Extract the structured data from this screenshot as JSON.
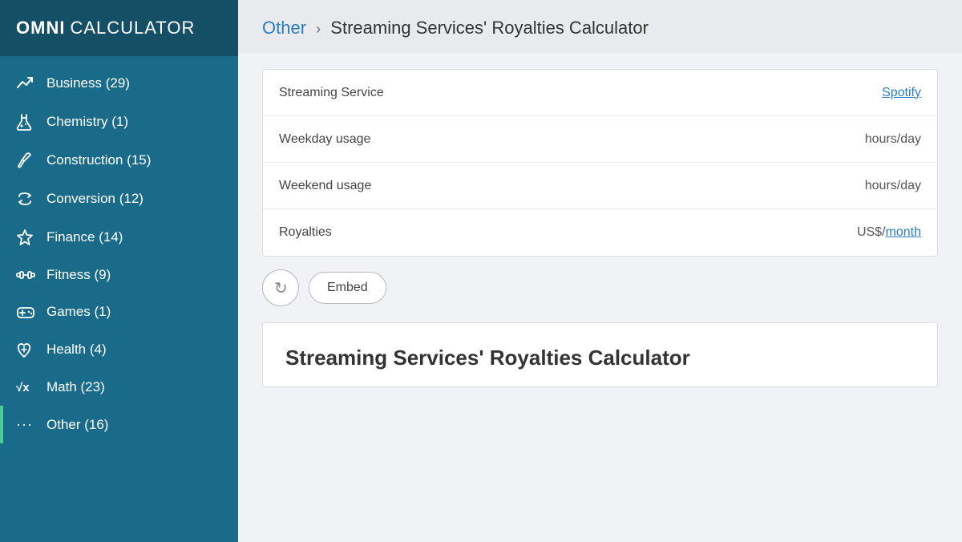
{
  "sidebar": {
    "logo_omni": "OMNI",
    "logo_calculator": "CALCULATOR",
    "items": [
      {
        "id": "business",
        "label": "Business (29)",
        "icon": "📈"
      },
      {
        "id": "chemistry",
        "label": "Chemistry (1)",
        "icon": "🧪"
      },
      {
        "id": "construction",
        "label": "Construction (15)",
        "icon": "🔧"
      },
      {
        "id": "conversion",
        "label": "Conversion (12)",
        "icon": "🔄"
      },
      {
        "id": "finance",
        "label": "Finance (14)",
        "icon": "💎"
      },
      {
        "id": "fitness",
        "label": "Fitness (9)",
        "icon": "🏋"
      },
      {
        "id": "games",
        "label": "Games (1)",
        "icon": "🎮"
      },
      {
        "id": "health",
        "label": "Health (4)",
        "icon": "🩺"
      },
      {
        "id": "math",
        "label": "Math (23)",
        "icon": "√x"
      },
      {
        "id": "other",
        "label": "Other (16)",
        "icon": "···"
      }
    ]
  },
  "breadcrumb": {
    "other_label": "Other",
    "separator": "›",
    "current_label": "Streaming Services' Royalties Calculator"
  },
  "calculator": {
    "rows": [
      {
        "label": "Streaming Service",
        "value": "Spotify",
        "value_link": true
      },
      {
        "label": "Weekday usage",
        "value": "hours/day",
        "value_link": false
      },
      {
        "label": "Weekend usage",
        "value": "hours/day",
        "value_link": false
      },
      {
        "label": "Royalties",
        "value": "US$/month",
        "value_link": true,
        "value_prefix": "US$/",
        "value_link_text": "month"
      }
    ]
  },
  "buttons": {
    "reset_icon": "↺",
    "embed_label": "Embed"
  },
  "article": {
    "title": "Streaming Services' Royalties Calculator"
  }
}
